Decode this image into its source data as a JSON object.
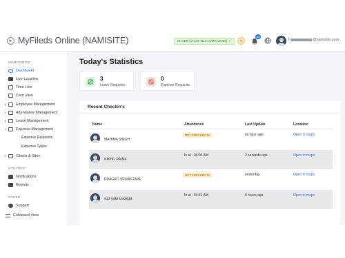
{
  "header": {
    "app_title": "MyFileds Online (NAMISITE)",
    "plan_badge": "SILVER (VALID TILL:12/MAY/2025) ✓",
    "notification_count": "23",
    "user_name_prefix": "h",
    "user_name_suffix": "@namisite.com"
  },
  "sidebar": {
    "sections": {
      "monitoring": "MONITORING",
      "utilities": "UTILITIES",
      "other": "OTHER"
    },
    "items": [
      {
        "label": "Dashboard",
        "icon": "dashboard-icon",
        "active": true
      },
      {
        "label": "Live Location",
        "icon": "location-icon"
      },
      {
        "label": "Time Line",
        "icon": "timeline-icon"
      },
      {
        "label": "Card View",
        "icon": "card-view-icon"
      },
      {
        "label": "Employee Management",
        "icon": "employee-icon",
        "expandable": true
      },
      {
        "label": "Attendance Management",
        "icon": "attendance-icon",
        "expandable": true
      },
      {
        "label": "Leave Management",
        "icon": "leave-icon",
        "expandable": true
      },
      {
        "label": "Expense Management",
        "icon": "expense-icon",
        "expandable": true,
        "expanded": true
      },
      {
        "label": "Clients & Sites",
        "icon": "clients-icon",
        "expandable": true
      },
      {
        "label": "Notifications",
        "icon": "bell-icon"
      },
      {
        "label": "Reports",
        "icon": "reports-icon"
      },
      {
        "label": "Support",
        "icon": "support-icon"
      }
    ],
    "sub_items": [
      "Expense Requests",
      "Expense Types"
    ],
    "collapse_label": "Collapsed View"
  },
  "main": {
    "title": "Today's Statistics",
    "stats": [
      {
        "value": "3",
        "label": "Leave Requests",
        "color": "#2e9b45"
      },
      {
        "value": "0",
        "label": "Expense Requests",
        "color": "#e0534f"
      }
    ],
    "recent": {
      "title": "Recent Checkin's",
      "columns": [
        "Name",
        "Attendence",
        "Last Update",
        "Location"
      ],
      "rows": [
        {
          "name": "MAHIMA SINGH",
          "attendance": "NOT CHECKED IN",
          "attendance_badge": true,
          "last_update": "an hour ago",
          "location": "Open in maps"
        },
        {
          "name": "NIKHIL RAINA",
          "attendance": "In at : 04:03 AM",
          "attendance_badge": false,
          "last_update": "2 seconds ago",
          "location": "Open in maps"
        },
        {
          "name": "PRAGATI SRIVASTAVA",
          "attendance": "NOT CHECKED IN",
          "attendance_badge": true,
          "last_update": "yesterday",
          "location": "Open in maps"
        },
        {
          "name": "SATYAM MISHRA",
          "attendance": "In at : 04:31 AM",
          "attendance_badge": false,
          "last_update": "6 hours ago",
          "location": "Open in maps"
        }
      ]
    }
  },
  "colors": {
    "accent": "#2f6fe0",
    "badge_bg": "#fde9c9",
    "badge_text": "#b06b10",
    "plan_green": "#3d8b2f"
  }
}
